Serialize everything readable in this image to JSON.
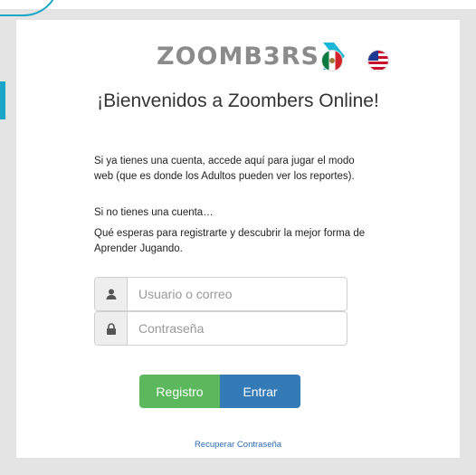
{
  "logo": {
    "text": "ZOOMB3RS"
  },
  "flags": [
    {
      "name": "mexico",
      "color": "#0b7a3e"
    },
    {
      "name": "usa",
      "color": "#c8102e"
    }
  ],
  "title": "¡Bienvenidos a Zoombers Online!",
  "paragraphs": {
    "p1": "Si ya tienes una cuenta, accede aquí para jugar el modo web (que es donde los Adultos pueden ver los reportes).",
    "p2": "Si no tienes una cuenta…",
    "p3": "Qué esperas para registrarte y descubrir la mejor forma de Aprender Jugando."
  },
  "form": {
    "username_placeholder": "Usuario o correo",
    "username_value": "",
    "password_placeholder": "Contraseña",
    "password_value": "",
    "user_icon": "user-icon",
    "lock_icon": "lock-icon"
  },
  "buttons": {
    "register": "Registro",
    "login": "Entrar",
    "register_color": "#5cb85c",
    "login_color": "#337ab7"
  },
  "links": {
    "recover": "Recuperar Contraseña"
  }
}
